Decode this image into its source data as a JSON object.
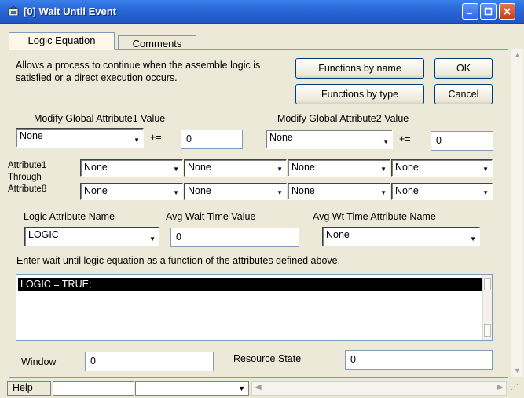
{
  "window": {
    "title": "[0]   Wait Until Event"
  },
  "tabs": [
    {
      "label": "Logic Equation",
      "active": true
    },
    {
      "label": "Comments",
      "active": false
    }
  ],
  "description": "Allows a process to continue when the assemble logic is satisfied or a direct execution occurs.",
  "buttons": {
    "functions_by_name": "Functions by name",
    "ok": "OK",
    "functions_by_type": "Functions by type",
    "cancel": "Cancel"
  },
  "global_attr1": {
    "label": "Modify Global Attribute1 Value",
    "select": "None",
    "op": "+=",
    "value": "0"
  },
  "global_attr2": {
    "label": "Modify Global Attribute2 Value",
    "select": "None",
    "op": "+=",
    "value": "0"
  },
  "attributes": {
    "label_lines": [
      "Attribute1",
      "Through",
      "Attribute8"
    ],
    "values": [
      "None",
      "None",
      "None",
      "None",
      "None",
      "None",
      "None",
      "None"
    ]
  },
  "logic_attr": {
    "label": "Logic Attribute Name",
    "value": "LOGIC"
  },
  "avg_wait": {
    "label": "Avg Wait Time Value",
    "value": "0"
  },
  "avg_wt_attr": {
    "label": "Avg Wt Time Attribute Name",
    "value": "None"
  },
  "equation": {
    "label": "Enter wait until logic equation as a function of the attributes defined above.",
    "text": "LOGIC = TRUE;"
  },
  "window_field": {
    "label": "Window",
    "value": "0"
  },
  "resource_state": {
    "label": "Resource State",
    "value": "0"
  },
  "statusbar": {
    "help": "Help"
  },
  "colors": {
    "titlebar": "#2a68d8",
    "close_button": "#c3401b",
    "selection_bg": "#000000"
  }
}
